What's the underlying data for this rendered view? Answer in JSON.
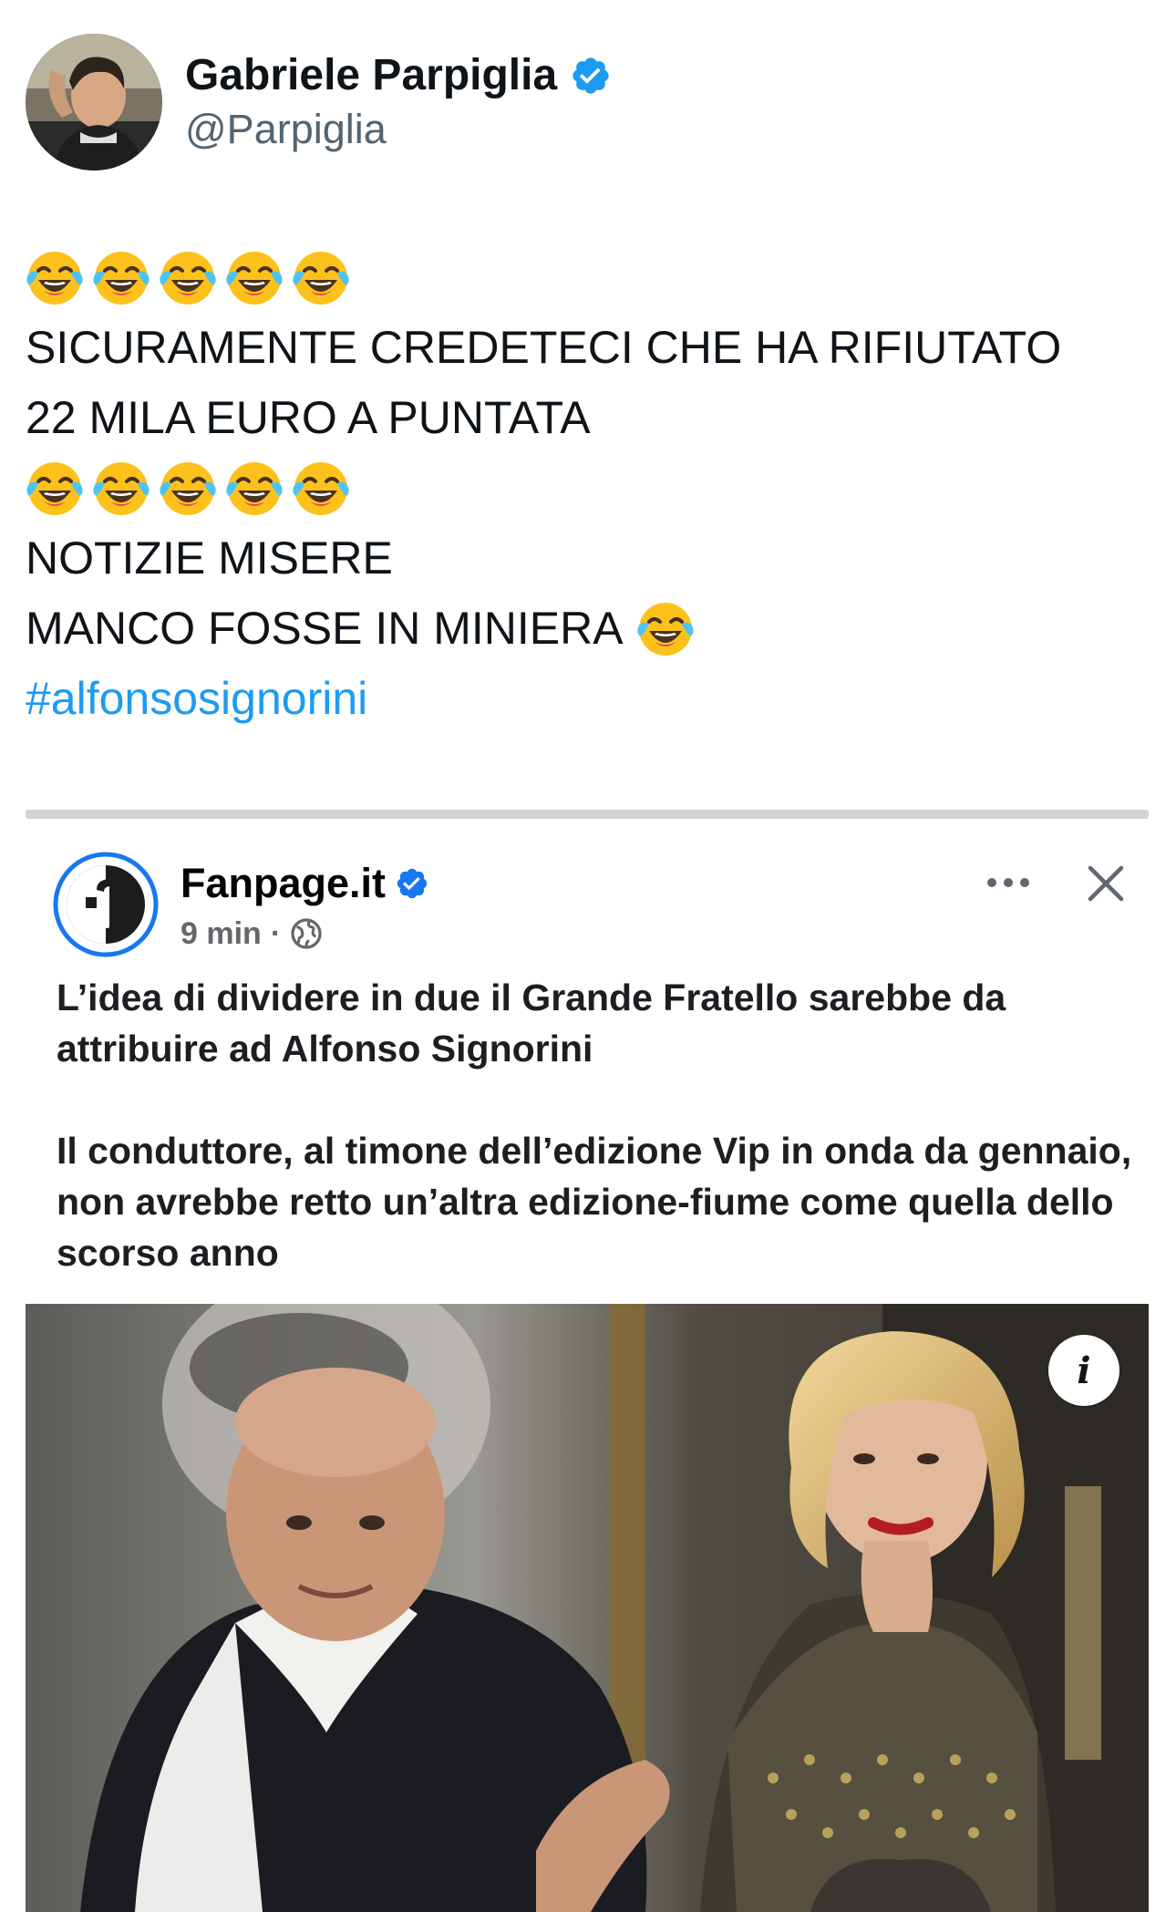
{
  "tweet": {
    "author": {
      "name": "Gabriele Parpiglia",
      "handle": "@Parpiglia",
      "verified": true,
      "avatar_icon": "profile-photo"
    },
    "lines": [
      {
        "type": "emoji",
        "emoji": "😂",
        "count": 5
      },
      {
        "type": "text",
        "text": "SICURAMENTE CREDETECI CHE HA RIFIUTATO"
      },
      {
        "type": "text",
        "text": "22 MILA EURO A PUNTATA"
      },
      {
        "type": "emoji",
        "emoji": "😂",
        "count": 5
      },
      {
        "type": "text",
        "text": "NOTIZIE MISERE"
      },
      {
        "type": "text",
        "text": "MANCO FOSSE IN MINIERA",
        "trailing_emoji": "😂"
      },
      {
        "type": "hashtag",
        "text": "#alfonsosignorini"
      }
    ],
    "colors": {
      "text": "#0f1419",
      "secondary": "#536471",
      "link": "#1d9bf0",
      "verified": "#1d9bf0"
    }
  },
  "embedded_post": {
    "page_name": "Fanpage.it",
    "verified": true,
    "time": "9 min",
    "separator": "·",
    "audience_icon": "globe-icon",
    "actions": [
      "more-icon",
      "close-icon"
    ],
    "headline": "L’idea di dividere in due il Grande Fratello sarebbe da attribuire ad Alfonso Signorini",
    "body": "Il conduttore, al timone dell’edizione Vip in onda da gennaio, non avrebbe retto un’altra edizione-fiume come quella dello scorso anno",
    "photo_info_label": "i",
    "photo_icon": "tv-studio-photo"
  }
}
